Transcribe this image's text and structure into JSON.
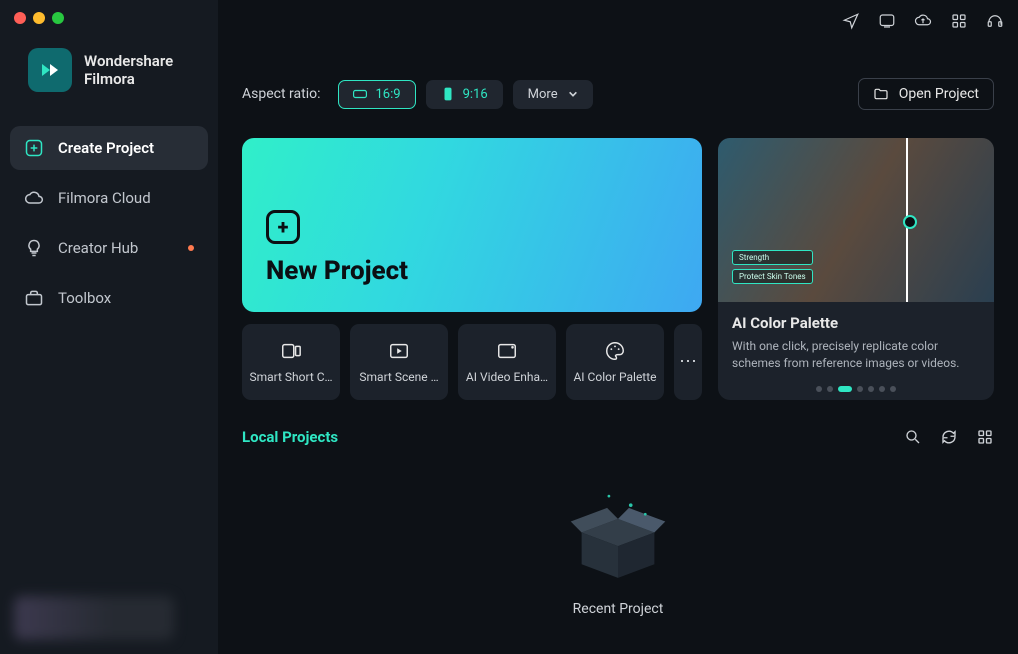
{
  "brand": {
    "line1": "Wondershare",
    "line2": "Filmora"
  },
  "sidebar": {
    "items": [
      {
        "label": "Create Project",
        "icon": "plus-square-icon",
        "active": true
      },
      {
        "label": "Filmora Cloud",
        "icon": "cloud-icon"
      },
      {
        "label": "Creator Hub",
        "icon": "bulb-icon",
        "dot": true
      },
      {
        "label": "Toolbox",
        "icon": "toolbox-icon"
      }
    ]
  },
  "ratio": {
    "label": "Aspect ratio:",
    "options": [
      {
        "label": "16:9",
        "shape": "landscape",
        "selected": true
      },
      {
        "label": "9:16",
        "shape": "portrait"
      }
    ],
    "more": "More"
  },
  "open_project": "Open Project",
  "new_project": {
    "title": "New Project"
  },
  "tools": [
    {
      "label": "Smart Short C…"
    },
    {
      "label": "Smart Scene …"
    },
    {
      "label": "AI Video Enha…"
    },
    {
      "label": "AI Color Palette"
    }
  ],
  "feature": {
    "title": "AI Color Palette",
    "desc": "With one click, precisely replicate color schemes from reference images or videos.",
    "tags": [
      "Strength",
      "Protect Skin Tones"
    ],
    "dot_count": 7,
    "active_dot": 2
  },
  "section": {
    "title": "Local Projects"
  },
  "empty": {
    "label": "Recent Project"
  }
}
